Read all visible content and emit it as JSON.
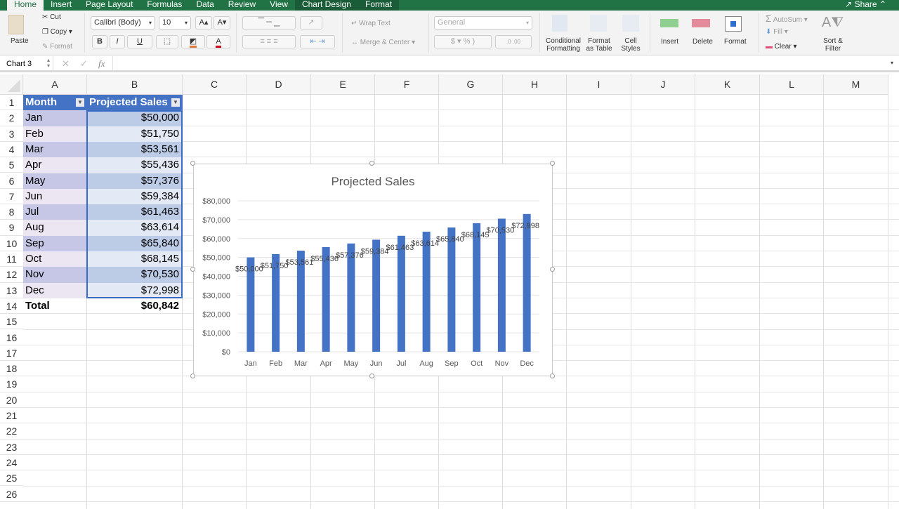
{
  "ribbon_tabs": [
    "Home",
    "Insert",
    "Page Layout",
    "Formulas",
    "Data",
    "Review",
    "View",
    "Chart Design",
    "Format"
  ],
  "active_tab": "Home",
  "share_label": "Share",
  "clipboard": {
    "paste": "Paste",
    "cut": "Cut",
    "copy": "Copy",
    "format": "Format"
  },
  "font": {
    "name": "Calibri (Body)",
    "size": "10",
    "bold": "B",
    "italic": "I",
    "underline": "U",
    "grow": "A▴",
    "shrink": "A▾"
  },
  "alignment": {
    "wrap_text": "Wrap Text",
    "merge_center": "Merge & Center"
  },
  "number": {
    "format": "General",
    "currency": "$",
    "percent": "%",
    "comma": ")"
  },
  "styles": {
    "conditional": "Conditional Formatting",
    "format_table": "Format as Table",
    "cell_styles": "Cell Styles"
  },
  "cells": {
    "insert": "Insert",
    "delete": "Delete",
    "format": "Format"
  },
  "editing": {
    "autosum": "AutoSum",
    "fill": "Fill",
    "clear": "Clear",
    "sort_filter": "Sort & Filter"
  },
  "formula_bar": {
    "name_box": "Chart 3",
    "fx": "fx",
    "value": ""
  },
  "columns": [
    "A",
    "B",
    "C",
    "D",
    "E",
    "F",
    "G",
    "H",
    "I",
    "J",
    "K",
    "L",
    "M"
  ],
  "rows": [
    "1",
    "2",
    "3",
    "4",
    "5",
    "6",
    "7",
    "8",
    "9",
    "10",
    "11",
    "12",
    "13",
    "14",
    "15",
    "16",
    "17",
    "18",
    "19",
    "20",
    "21",
    "22",
    "23",
    "24",
    "25",
    "26"
  ],
  "table": {
    "headers": [
      "Month",
      "Projected Sales"
    ],
    "rows": [
      [
        "Jan",
        "$50,000"
      ],
      [
        "Feb",
        "$51,750"
      ],
      [
        "Mar",
        "$53,561"
      ],
      [
        "Apr",
        "$55,436"
      ],
      [
        "May",
        "$57,376"
      ],
      [
        "Jun",
        "$59,384"
      ],
      [
        "Jul",
        "$61,463"
      ],
      [
        "Aug",
        "$63,614"
      ],
      [
        "Sep",
        "$65,840"
      ],
      [
        "Oct",
        "$68,145"
      ],
      [
        "Nov",
        "$70,530"
      ],
      [
        "Dec",
        "$72,998"
      ]
    ],
    "total_label": "Total",
    "total_value": "$60,842"
  },
  "colors": {
    "ribbon_green": "#217346",
    "table_header": "#4472c4",
    "bar": "#4472c4"
  },
  "chart_data": {
    "type": "bar",
    "title": "Projected Sales",
    "categories": [
      "Jan",
      "Feb",
      "Mar",
      "Apr",
      "May",
      "Jun",
      "Jul",
      "Aug",
      "Sep",
      "Oct",
      "Nov",
      "Dec"
    ],
    "values": [
      50000,
      51750,
      53561,
      55436,
      57376,
      59384,
      61463,
      63614,
      65840,
      68145,
      70530,
      72998
    ],
    "data_labels": [
      "$50,000",
      "$51,750",
      "$53,561",
      "$55,436",
      "$57,376",
      "$59,384",
      "$61,463",
      "$63,614",
      "$65,840",
      "$68,145",
      "$70,530",
      "$72,998"
    ],
    "yticks": [
      "$0",
      "$10,000",
      "$20,000",
      "$30,000",
      "$40,000",
      "$50,000",
      "$60,000",
      "$70,000",
      "$80,000"
    ],
    "ylim": [
      0,
      80000
    ],
    "xlabel": "",
    "ylabel": "",
    "grid": true,
    "legend": "none"
  }
}
